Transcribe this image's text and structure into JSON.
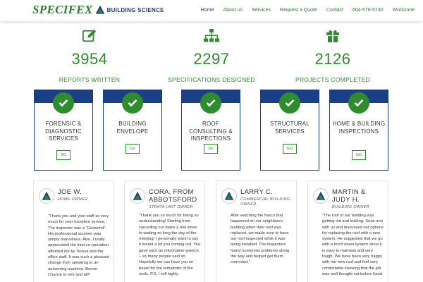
{
  "brand": {
    "name": "SPECIFEX",
    "subtitle": "BUILDING SCIENCE"
  },
  "nav": [
    {
      "label": "Home",
      "active": true
    },
    {
      "label": "About us"
    },
    {
      "label": "Services"
    },
    {
      "label": "Request a Quote"
    },
    {
      "label": "Contact"
    },
    {
      "label": "604-576-5740"
    },
    {
      "label": "Workzone"
    }
  ],
  "stats": [
    {
      "icon": "edit-icon",
      "value": "3954",
      "label": "REPORTS WRITTEN"
    },
    {
      "icon": "sitemap-icon",
      "value": "2297",
      "label": "SPECIFICATIONS DESIGNED"
    },
    {
      "icon": "gift-icon",
      "value": "2126",
      "label": "PROJECTS COMPLETED"
    }
  ],
  "services": [
    {
      "title": "FORENSIC & DIAGNOSTIC SERVICES",
      "button": "GO"
    },
    {
      "title": "BUILDING ENVELOPE",
      "button": "Go"
    },
    {
      "title": "ROOF CONSULTING & INSPECTIONS",
      "button": "Go"
    },
    {
      "title": "STRUCTURAL SERVICES",
      "button": "GO"
    },
    {
      "title": "HOME & BUILDING INSPECTIONS",
      "button": "GO"
    }
  ],
  "testimonials": [
    {
      "name": "JOE W.",
      "role": "HOME OWNER",
      "quote": "\"Thank you and your staff so very much for your excellent service. The inspector was a \"Godsend\". His professional acumen was simply marvellous. Also, I really appreciated the kind co-operation afforded me by Teresa and the office staff. It was such a pleasant change from speaking to an answering machine. Bonne Chance to one and all!\""
    },
    {
      "name": "CORA, FROM ABBOTSFORD",
      "role": "STRATA UNIT OWNER",
      "quote": "\"Thank you so much for being so understanding! Starting from cancelling our dates a few times to waiting so long the day of the meeting! I personally want to say it meant a lot you coming out. You gave such an informative speech – so many people said so. Hopefully we can have you on board for the remainder of the roofs. P.S. I will highly"
    },
    {
      "name": "LARRY C.",
      "role": "COMMERCIAL BUILDING OWNER",
      "quote": "After watching the fiasco that happened on our neighbours building when their roof was replaced, we made sure to have our roof inspected while it was being installed. The inspectors found numerous problems along the way and helped get them corrected.\""
    },
    {
      "name": "MARTIN & JUDY H.",
      "role": "BUILDING OWNER",
      "quote": "\"The roof of our building was getting old and leaking. Sean met with us and discussed our options for replacing the roof with a new system. He suggested that we go with a torch down system since it is easy to maintain and very tough. We have been very happy with our new roof and feel very comfortable knowing that the job was well thought out before hand"
    }
  ],
  "colors": {
    "green": "#2e8b2e",
    "navy": "#1b3f86"
  }
}
